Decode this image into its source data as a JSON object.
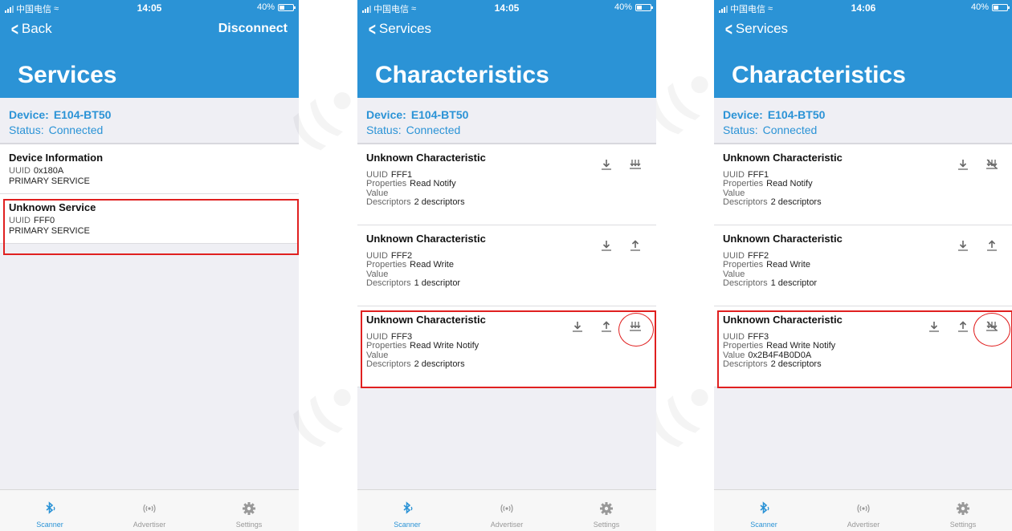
{
  "status_bar": [
    {
      "carrier": "中国电信",
      "time": "14:05",
      "battery": "40%",
      "battery_level": 0.4
    },
    {
      "carrier": "中国电信",
      "time": "14:05",
      "battery": "40%",
      "battery_level": 0.4
    },
    {
      "carrier": "中国电信",
      "time": "14:06",
      "battery": "40%",
      "battery_level": 0.4
    }
  ],
  "screen1": {
    "back_label": "Back",
    "disconnect_label": "Disconnect",
    "title": "Services",
    "device_label": "Device:",
    "device_name": "E104-BT50",
    "status_label": "Status:",
    "status_value": "Connected",
    "services": [
      {
        "name": "Device Information",
        "uuid_label": "UUID",
        "uuid": "0x180A",
        "type": "PRIMARY SERVICE"
      },
      {
        "name": "Unknown Service",
        "uuid_label": "UUID",
        "uuid": "FFF0",
        "type": "PRIMARY SERVICE"
      }
    ]
  },
  "screen2": {
    "back_label": "Services",
    "title": "Characteristics",
    "device_label": "Device:",
    "device_name": "E104-BT50",
    "status_label": "Status:",
    "status_value": "Connected",
    "characteristics": [
      {
        "name": "Unknown Characteristic",
        "uuid_label": "UUID",
        "uuid": "FFF1",
        "properties_label": "Properties",
        "properties": "Read Notify",
        "value_label": "Value",
        "value": "",
        "descriptors_label": "Descriptors",
        "descriptors": "2 descriptors"
      },
      {
        "name": "Unknown Characteristic",
        "uuid_label": "UUID",
        "uuid": "FFF2",
        "properties_label": "Properties",
        "properties": "Read Write",
        "value_label": "Value",
        "value": "",
        "descriptors_label": "Descriptors",
        "descriptors": "1 descriptor"
      },
      {
        "name": "Unknown Characteristic",
        "uuid_label": "UUID",
        "uuid": "FFF3",
        "properties_label": "Properties",
        "properties": "Read Write Notify",
        "value_label": "Value",
        "value": "",
        "descriptors_label": "Descriptors",
        "descriptors": "2 descriptors"
      }
    ]
  },
  "screen3": {
    "back_label": "Services",
    "title": "Characteristics",
    "device_label": "Device:",
    "device_name": "E104-BT50",
    "status_label": "Status:",
    "status_value": "Connected",
    "characteristics": [
      {
        "name": "Unknown Characteristic",
        "uuid_label": "UUID",
        "uuid": "FFF1",
        "properties_label": "Properties",
        "properties": "Read Notify",
        "value_label": "Value",
        "value": "",
        "descriptors_label": "Descriptors",
        "descriptors": "2 descriptors"
      },
      {
        "name": "Unknown Characteristic",
        "uuid_label": "UUID",
        "uuid": "FFF2",
        "properties_label": "Properties",
        "properties": "Read Write",
        "value_label": "Value",
        "value": "",
        "descriptors_label": "Descriptors",
        "descriptors": "1 descriptor"
      },
      {
        "name": "Unknown Characteristic",
        "uuid_label": "UUID",
        "uuid": "FFF3",
        "properties_label": "Properties",
        "properties": "Read Write Notify",
        "value_label": "Value",
        "value": "0x2B4F4B0D0A",
        "descriptors_label": "Descriptors",
        "descriptors": "2 descriptors"
      }
    ]
  },
  "tabbar": {
    "scanner": "Scanner",
    "advertiser": "Advertiser",
    "settings": "Settings"
  },
  "watermark": "EBYTE",
  "colors": {
    "header_blue": "#2b93d6",
    "highlight_red": "#e02020",
    "inactive_grey": "#999999"
  }
}
